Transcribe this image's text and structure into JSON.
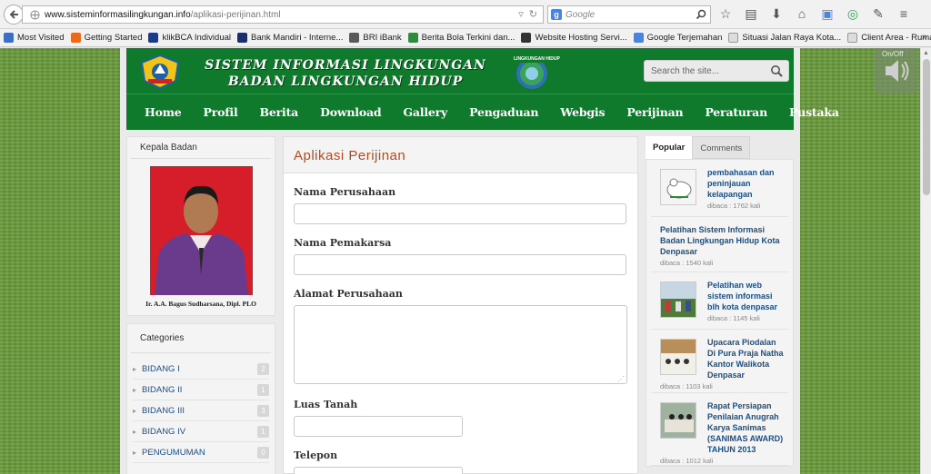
{
  "browser": {
    "url_host": "www.sisteminformasilingkungan.info",
    "url_path": "/aplikasi-perijinan.html",
    "search_engine_placeholder": "Google",
    "bookmarks": [
      {
        "label": "Most Visited",
        "color": "#3c6fc4"
      },
      {
        "label": "Getting Started",
        "color": "#e86b1f"
      },
      {
        "label": "klikBCA Individual",
        "color": "#1b3a8a"
      },
      {
        "label": "Bank Mandiri - Interne...",
        "color": "#1b2f6e"
      },
      {
        "label": "BRI iBank",
        "color": "#5a5a5a"
      },
      {
        "label": "Berita Bola Terkini dan...",
        "color": "#2e8b3d"
      },
      {
        "label": "Website Hosting Servi...",
        "color": "#333333"
      },
      {
        "label": "Google Terjemahan",
        "color": "#4a84e0"
      },
      {
        "label": "Situasi Jalan Raya Kota...",
        "color": "#dddddd"
      },
      {
        "label": "Client Area - Rumahw...",
        "color": "#dddddd"
      }
    ]
  },
  "site": {
    "title_line1": "SISTEM INFORMASI LINGKUNGAN",
    "title_line2": "BADAN LINGKUNGAN HIDUP",
    "logo_text": "LINGKUNGAN HIDUP",
    "search_placeholder": "Search the site...",
    "nav": [
      "Home",
      "Profil",
      "Berita",
      "Download",
      "Gallery",
      "Pengaduan",
      "Webgis",
      "Perijinan",
      "Peraturan",
      "Pustaka"
    ]
  },
  "left": {
    "kepala_title": "Kepala Badan",
    "kepala_caption": "Ir. A.A. Bagus Sudharsana, Dipl. PLO",
    "categories_title": "Categories",
    "categories": [
      {
        "label": "BIDANG I",
        "count": "2"
      },
      {
        "label": "BIDANG II",
        "count": "1"
      },
      {
        "label": "BIDANG III",
        "count": "3"
      },
      {
        "label": "BIDANG IV",
        "count": "1"
      },
      {
        "label": "PENGUMUMAN",
        "count": "0"
      }
    ]
  },
  "main": {
    "title": "Aplikasi Perijinan",
    "fields": [
      {
        "label": "Nama Perusahaan",
        "value": ""
      },
      {
        "label": "Nama Pemakarsa",
        "value": ""
      },
      {
        "label": "Alamat Perusahaan",
        "value": ""
      },
      {
        "label": "Luas Tanah",
        "value": ""
      },
      {
        "label": "Telepon",
        "value": ""
      }
    ]
  },
  "right": {
    "tabs": [
      "Popular",
      "Comments"
    ],
    "popular": [
      {
        "title": "pembahasan dan peninjauan kelapangan",
        "meta": "dibaca : 1762 kali"
      },
      {
        "title": "Pelatihan Sistem Informasi Badan Lingkungan Hidup Kota Denpasar",
        "meta": "dibaca : 1540 kali"
      },
      {
        "title": "Pelatihan web sistem informasi blh kota denpasar",
        "meta": "dibaca : 1145 kali"
      },
      {
        "title": "Upacara Piodalan Di Pura Praja Natha Kantor Walikota Denpasar",
        "meta": "dibaca : 1103 kali"
      },
      {
        "title": "Rapat Persiapan Penilaian Anugrah Karya Sanimas (SANIMAS AWARD) TAHUN 2013",
        "meta": "dibaca : 1012 kali"
      }
    ]
  },
  "widget": {
    "onoff": "On/Off"
  }
}
